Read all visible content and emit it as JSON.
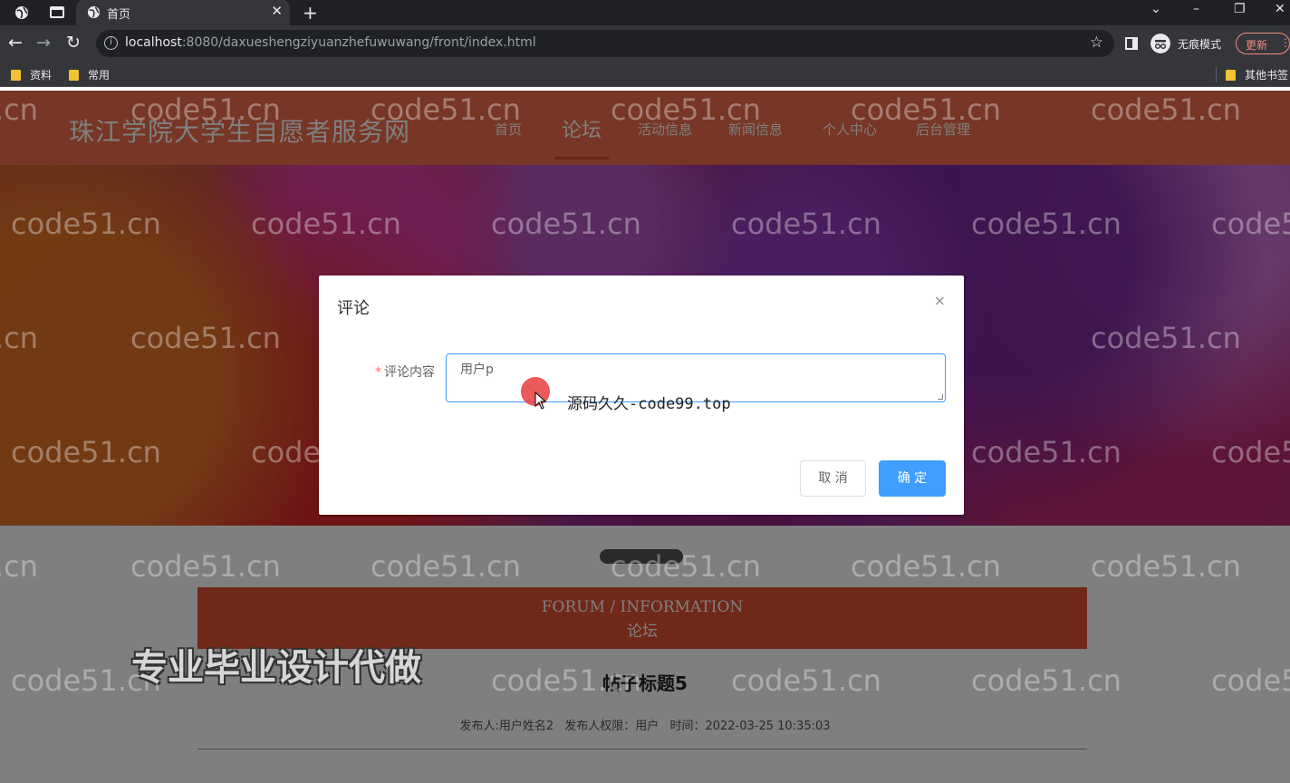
{
  "browser": {
    "tab_title": "首页",
    "tab_close": "✕",
    "new_tab": "+",
    "window_controls": [
      "⌄",
      "–",
      "❐",
      "✕"
    ],
    "url_host": "localhost",
    "url_rest": ":8080/daxueshengziyuanzhefuwuwang/front/index.html",
    "incognito_label": "无痕模式",
    "update_label": "更新",
    "bookmarks": [
      "资料",
      "常用"
    ],
    "other_bookmarks": "其他书签",
    "icons": {
      "back": "←",
      "forward": "→",
      "reload": "↻",
      "star": "☆",
      "info": "i"
    }
  },
  "site": {
    "title": "珠江学院大学生自愿者服务网",
    "menu": [
      "首页",
      "论坛",
      "活动信息",
      "新闻信息",
      "个人中心",
      "后台管理"
    ],
    "active_menu": "论坛",
    "accent": "#ef6d4c"
  },
  "forum": {
    "heading_en": "FORUM / INFORMATION",
    "heading_cn": "论坛",
    "post_title": "帖子标题5",
    "meta_author": "发布人:用户姓名2",
    "meta_role": "发布人权限：用户",
    "meta_time": "时间：2022-03-25 10:35:03"
  },
  "dialog": {
    "title": "评论",
    "close": "×",
    "required_mark": "*",
    "field_label": "评论内容",
    "field_value": "用户p",
    "cancel_label": "取 消",
    "confirm_label": "确 定"
  },
  "watermarks": {
    "site": "code51.cn",
    "edge": ".cn",
    "edge_right": "code5",
    "source": "源码久久-code99.top",
    "promo": "专业毕业设计代做"
  }
}
